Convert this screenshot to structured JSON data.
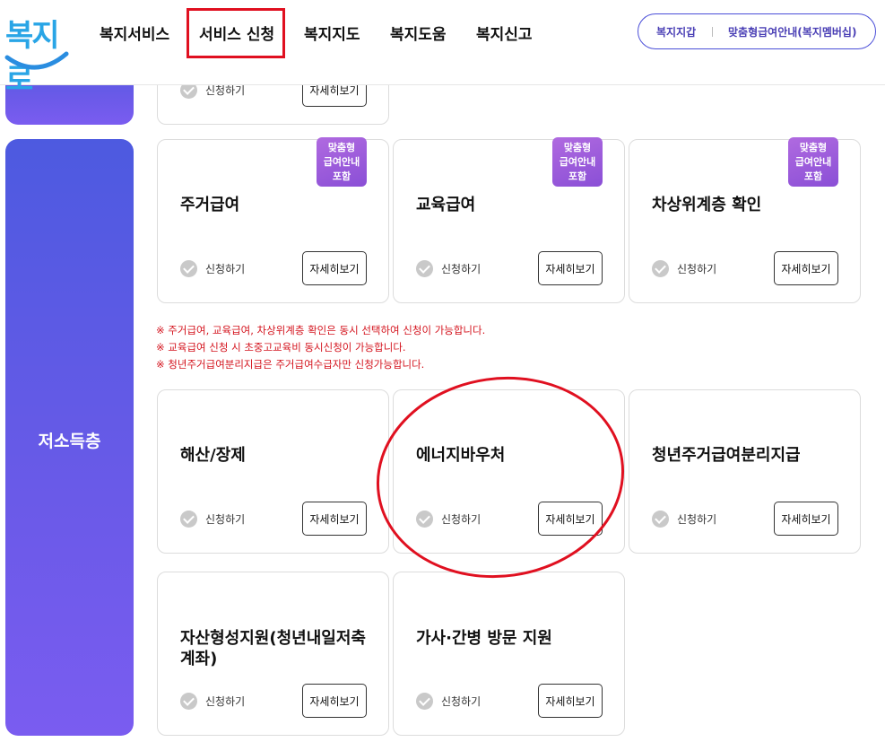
{
  "header": {
    "logo_text": "복지로",
    "nav": [
      {
        "label": "복지서비스"
      },
      {
        "label": "서비스 신청"
      },
      {
        "label": "복지지도"
      },
      {
        "label": "복지도움"
      },
      {
        "label": "복지신고"
      }
    ],
    "quick_links": [
      {
        "label": "복지지갑"
      },
      {
        "label": "맞춤형급여안내(복지멤버십)"
      }
    ]
  },
  "top_partial_card": {
    "apply_label": "신청하기",
    "detail_label": "자세히보기"
  },
  "section": {
    "label": "저소득층",
    "rows": [
      [
        {
          "title": "주거급여",
          "badge": [
            "맞춤형",
            "급여안내",
            "포함"
          ],
          "apply_label": "신청하기",
          "detail_label": "자세히보기"
        },
        {
          "title": "교육급여",
          "badge": [
            "맞춤형",
            "급여안내",
            "포함"
          ],
          "apply_label": "신청하기",
          "detail_label": "자세히보기"
        },
        {
          "title": "차상위계층 확인",
          "badge": [
            "맞춤형",
            "급여안내",
            "포함"
          ],
          "apply_label": "신청하기",
          "detail_label": "자세히보기"
        }
      ],
      [
        {
          "title": "해산/장제",
          "apply_label": "신청하기",
          "detail_label": "자세히보기"
        },
        {
          "title": "에너지바우처",
          "apply_label": "신청하기",
          "detail_label": "자세히보기"
        },
        {
          "title": "청년주거급여분리지급",
          "apply_label": "신청하기",
          "detail_label": "자세히보기"
        }
      ],
      [
        {
          "title": "자산형성지원(청년내일저축계좌)",
          "apply_label": "신청하기",
          "detail_label": "자세히보기"
        },
        {
          "title": "가사·간병 방문 지원",
          "apply_label": "신청하기",
          "detail_label": "자세히보기"
        }
      ]
    ],
    "notes": [
      "※ 주거급여, 교육급여, 차상위계층 확인은 동시 선택하여 신청이 가능합니다.",
      "※ 교육급여 신청 시 초중고교육비 동시신청이 가능합니다.",
      "※ 청년주거급여분리지급은 주거급여수급자만 신청가능합니다."
    ]
  },
  "colors": {
    "brand_blue": "#29a5e6",
    "sidebar_purple": "#5b5ae4",
    "badge_purple": "#9b5be0",
    "note_red": "#d4141e",
    "annotation_red": "#e01020"
  }
}
